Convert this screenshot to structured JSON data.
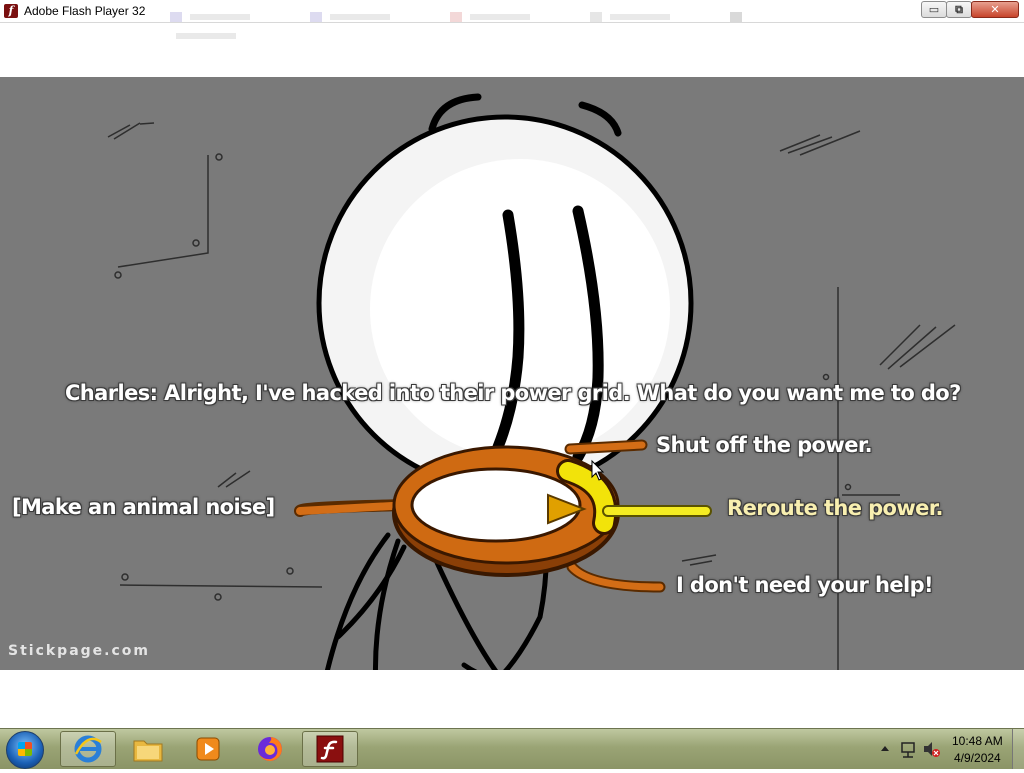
{
  "window": {
    "title": "Adobe Flash Player 32",
    "buttons": {
      "minimize": "▭",
      "maximize": "⧉",
      "close": "✕"
    }
  },
  "game": {
    "question": "Charles:  Alright, I've hacked into their power grid. What do you want me to do?",
    "options": {
      "up": "Shut off the power.",
      "left": "[Make an animal noise]",
      "right": "Reroute the power.",
      "down": "I don't need your help!"
    },
    "selected_option": "right",
    "watermark": "Stickpage.com",
    "colors": {
      "background": "#7a7a7a",
      "ring": "#c8650f",
      "selected": "#f2e30a",
      "selected_text": "#f8efb0"
    }
  },
  "taskbar": {
    "items": [
      {
        "name": "internet-explorer",
        "icon": "ie-icon"
      },
      {
        "name": "file-explorer",
        "icon": "folder-icon"
      },
      {
        "name": "media-player",
        "icon": "media-player-icon"
      },
      {
        "name": "firefox",
        "icon": "firefox-icon"
      },
      {
        "name": "flash-player",
        "icon": "flash-icon"
      }
    ],
    "clock": {
      "time": "10:48 AM",
      "date": "4/9/2024"
    }
  }
}
